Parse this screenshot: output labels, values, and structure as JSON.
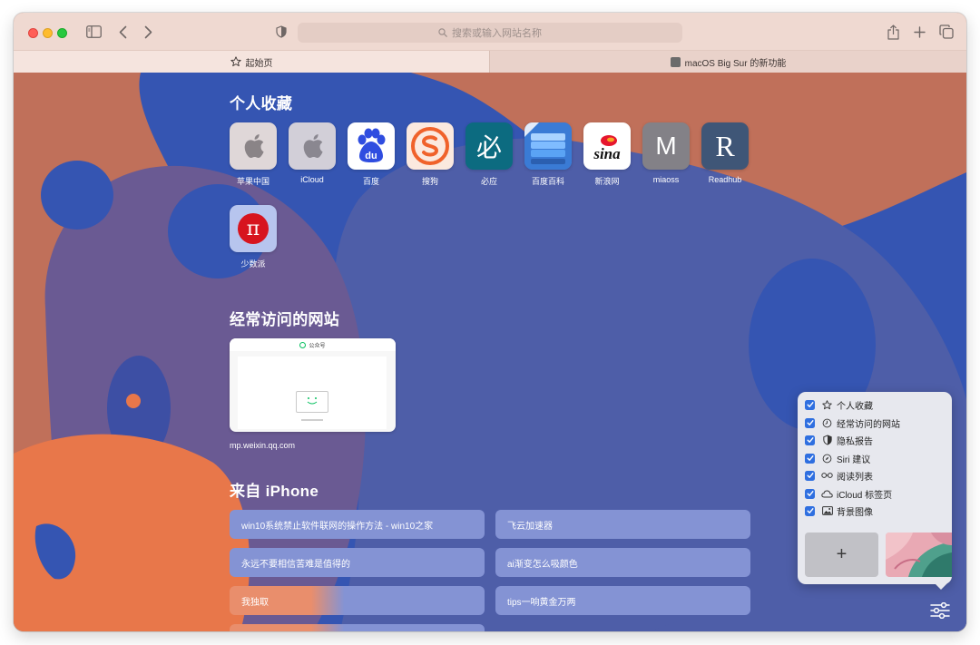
{
  "toolbar": {
    "search_placeholder": "搜索或输入网站名称"
  },
  "tabs": [
    {
      "label": "起始页",
      "active": true
    },
    {
      "label": "macOS Big Sur 的新功能",
      "active": false
    }
  ],
  "favorites": {
    "title": "个人收藏",
    "items": [
      {
        "label": "苹果中国",
        "icon": "apple-logo-icon"
      },
      {
        "label": "iCloud",
        "icon": "apple-logo-icon"
      },
      {
        "label": "百度",
        "icon": "baidu-paw-icon"
      },
      {
        "label": "搜狗",
        "icon": "sogou-icon"
      },
      {
        "label": "必应",
        "icon": "bing-icon",
        "glyph": "必"
      },
      {
        "label": "百度百科",
        "icon": "baike-book-icon"
      },
      {
        "label": "新浪网",
        "icon": "sina-icon",
        "glyph": "sina"
      },
      {
        "label": "miaoss",
        "icon": "letter-m-icon",
        "glyph": "M"
      },
      {
        "label": "Readhub",
        "icon": "letter-r-icon",
        "glyph": "R"
      },
      {
        "label": "少数派",
        "icon": "sspai-pi-icon",
        "glyph": "π"
      }
    ]
  },
  "frequently_visited": {
    "title": "经常访问的网站",
    "items": [
      {
        "label": "mp.weixin.qq.com",
        "preview_header": "公众号"
      }
    ]
  },
  "from_iphone": {
    "title": "来自 iPhone",
    "items": [
      "win10系统禁止软件联网的操作方法 - win10之家",
      "飞云加速器",
      "永远不要相信苦难是值得的",
      "ai渐变怎么吸颜色",
      "我独取",
      "tips一响黄金万两"
    ]
  },
  "customize_menu": {
    "items": [
      {
        "label": "个人收藏",
        "checked": true,
        "icon": "star-icon"
      },
      {
        "label": "经常访问的网站",
        "checked": true,
        "icon": "clock-icon"
      },
      {
        "label": "隐私报告",
        "checked": true,
        "icon": "shield-icon"
      },
      {
        "label": "Siri 建议",
        "checked": true,
        "icon": "compass-icon"
      },
      {
        "label": "阅读列表",
        "checked": true,
        "icon": "glasses-icon"
      },
      {
        "label": "iCloud 标签页",
        "checked": true,
        "icon": "cloud-icon"
      },
      {
        "label": "背景图像",
        "checked": true,
        "icon": "image-icon"
      }
    ],
    "add_background_label": "+"
  },
  "colors": {
    "background_orange": "#c0705a",
    "background_blue": "#3555b2",
    "checkbox_blue": "#2f6fe0",
    "iphone_item": "#8493d4"
  }
}
